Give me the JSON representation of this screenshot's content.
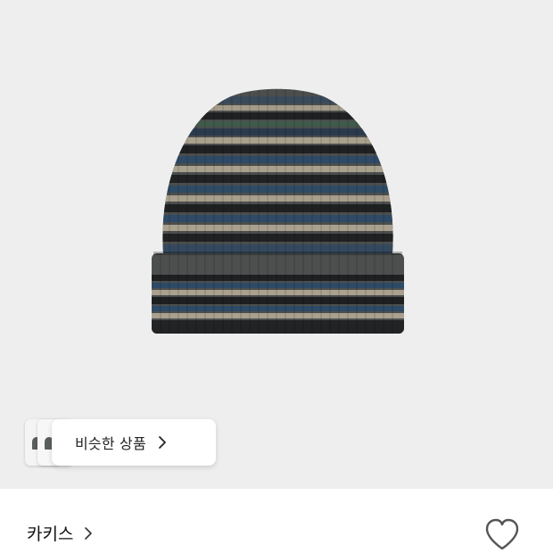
{
  "product": {
    "image_icon": "knit-beanie-product-image"
  },
  "similar": {
    "label": "비슷한 상품",
    "arrow_icon": "chevron-right-icon"
  },
  "brand": {
    "name": "카키스",
    "arrow_icon": "chevron-right-icon"
  },
  "wishlist": {
    "icon": "heart-outline-icon"
  },
  "colors": {
    "image_bg": "#eeeeef",
    "beanie_base": "#4a4d4c",
    "stripe_navy": "#2e4a66",
    "stripe_green": "#3f5a4a",
    "stripe_beige": "#a9a08e",
    "stripe_black": "#1f2021"
  }
}
